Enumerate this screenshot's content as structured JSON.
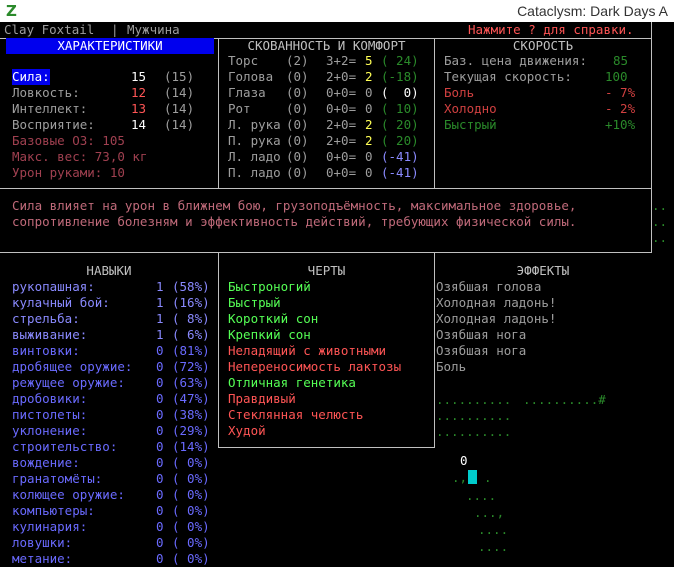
{
  "window": {
    "title": "Cataclysm: Dark Days A"
  },
  "character": {
    "name": "Clay Foxtail",
    "separator": "|",
    "gender": "Мужчина"
  },
  "help_hint": "Нажмите ? для справки.",
  "stats": {
    "header": "ХАРАКТЕРИСТИКИ",
    "rows": [
      {
        "label": "Сила:",
        "value": "15",
        "base": "(15)"
      },
      {
        "label": "Ловкость:",
        "value": "12",
        "base": "(14)"
      },
      {
        "label": "Интеллект:",
        "value": "13",
        "base": "(14)"
      },
      {
        "label": "Восприятие:",
        "value": "14",
        "base": "(14)"
      }
    ],
    "extra": [
      "Базовые ОЗ: 105",
      "Макс. вес: 73,0 кг",
      "Урон руками: 10"
    ]
  },
  "encumbrance": {
    "header": "СКОВАННОСТЬ И КОМФОРТ",
    "rows": [
      {
        "part": "Торс",
        "enc": "(2)",
        "calc": "3+2=",
        "total": "5",
        "warmth": "( 24)"
      },
      {
        "part": "Голова",
        "enc": "(0)",
        "calc": "2+0=",
        "total": "2",
        "warmth": "(-18)"
      },
      {
        "part": "Глаза",
        "enc": "(0)",
        "calc": "0+0=",
        "total": "0",
        "warmth": "(  0)"
      },
      {
        "part": "Рот",
        "enc": "(0)",
        "calc": "0+0=",
        "total": "0",
        "warmth": "( 10)"
      },
      {
        "part": "Л. рука",
        "enc": "(0)",
        "calc": "2+0=",
        "total": "2",
        "warmth": "( 20)"
      },
      {
        "part": "П. рука",
        "enc": "(0)",
        "calc": "2+0=",
        "total": "2",
        "warmth": "( 20)"
      },
      {
        "part": "Л. ладо",
        "enc": "(0)",
        "calc": "0+0=",
        "total": "0",
        "warmth": "(-41)"
      },
      {
        "part": "П. ладо",
        "enc": "(0)",
        "calc": "0+0=",
        "total": "0",
        "warmth": "(-41)"
      }
    ]
  },
  "speed": {
    "header": "СКОРОСТЬ",
    "rows": [
      {
        "label": "Баз. цена движения:",
        "value": "85"
      },
      {
        "label": "Текущая скорость:",
        "value": "100"
      },
      {
        "label": "Боль",
        "value": "- 7%"
      },
      {
        "label": "Холодно",
        "value": "- 2%"
      },
      {
        "label": "Быстрый",
        "value": "+10%"
      }
    ]
  },
  "description": [
    "Сила влияет на урон в ближнем бою, грузоподъёмность, максимальное здоровье,",
    "сопротивление болезням и эффективность действий, требующих физической силы."
  ],
  "skills": {
    "header": "НАВЫКИ",
    "rows": [
      {
        "name": "рукопашная:",
        "level": "1",
        "pct": "(58%)"
      },
      {
        "name": "кулачный бой:",
        "level": "1",
        "pct": "(16%)"
      },
      {
        "name": "стрельба:",
        "level": "1",
        "pct": "( 8%)"
      },
      {
        "name": "выживание:",
        "level": "1",
        "pct": "( 6%)"
      },
      {
        "name": "винтовки:",
        "level": "0",
        "pct": "(81%)"
      },
      {
        "name": "дробящее оружие:",
        "level": "0",
        "pct": "(72%)"
      },
      {
        "name": "режущее оружие:",
        "level": "0",
        "pct": "(63%)"
      },
      {
        "name": "дробовики:",
        "level": "0",
        "pct": "(47%)"
      },
      {
        "name": "пистолеты:",
        "level": "0",
        "pct": "(38%)"
      },
      {
        "name": "уклонение:",
        "level": "0",
        "pct": "(29%)"
      },
      {
        "name": "строительство:",
        "level": "0",
        "pct": "(14%)"
      },
      {
        "name": "вождение:",
        "level": "0",
        "pct": "( 0%)"
      },
      {
        "name": "гранатомёты:",
        "level": "0",
        "pct": "( 0%)"
      },
      {
        "name": "колющее оружие:",
        "level": "0",
        "pct": "( 0%)"
      },
      {
        "name": "компьютеры:",
        "level": "0",
        "pct": "( 0%)"
      },
      {
        "name": "кулинария:",
        "level": "0",
        "pct": "( 0%)"
      },
      {
        "name": "ловушки:",
        "level": "0",
        "pct": "( 0%)"
      },
      {
        "name": "метание:",
        "level": "0",
        "pct": "( 0%)"
      }
    ]
  },
  "traits": {
    "header": "ЧЕРТЫ",
    "rows": [
      {
        "name": "Быстроногий",
        "color": "#55ff55"
      },
      {
        "name": "Быстрый",
        "color": "#55ff55"
      },
      {
        "name": "Короткий сон",
        "color": "#55ff55"
      },
      {
        "name": "Крепкий сон",
        "color": "#55ff55"
      },
      {
        "name": "Неладящий с животными",
        "color": "#ff5555"
      },
      {
        "name": "Непереносимость лактозы",
        "color": "#ff5555"
      },
      {
        "name": "Отличная генетика",
        "color": "#55ff55"
      },
      {
        "name": "Правдивый",
        "color": "#ff5555"
      },
      {
        "name": "Стеклянная челюсть",
        "color": "#ff5555"
      },
      {
        "name": "Худой",
        "color": "#ff5555"
      }
    ]
  },
  "effects": {
    "header": "ЭФФЕКТЫ",
    "rows": [
      "Озябшая голова",
      "Холодная ладонь!",
      "Холодная ладонь!",
      "Озябшая нога",
      "Озябшая нога",
      "Боль"
    ]
  },
  "map": {
    "dots_row": "..........",
    "dots_right": "..........#",
    "player_symbol": "0"
  }
}
